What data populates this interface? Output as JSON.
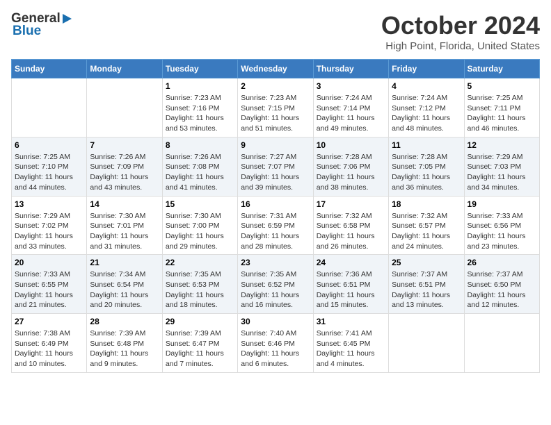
{
  "header": {
    "logo_general": "General",
    "logo_blue": "Blue",
    "title": "October 2024",
    "subtitle": "High Point, Florida, United States"
  },
  "calendar": {
    "days_of_week": [
      "Sunday",
      "Monday",
      "Tuesday",
      "Wednesday",
      "Thursday",
      "Friday",
      "Saturday"
    ],
    "weeks": [
      [
        {
          "day": "",
          "info": ""
        },
        {
          "day": "",
          "info": ""
        },
        {
          "day": "1",
          "info": "Sunrise: 7:23 AM\nSunset: 7:16 PM\nDaylight: 11 hours and 53 minutes."
        },
        {
          "day": "2",
          "info": "Sunrise: 7:23 AM\nSunset: 7:15 PM\nDaylight: 11 hours and 51 minutes."
        },
        {
          "day": "3",
          "info": "Sunrise: 7:24 AM\nSunset: 7:14 PM\nDaylight: 11 hours and 49 minutes."
        },
        {
          "day": "4",
          "info": "Sunrise: 7:24 AM\nSunset: 7:12 PM\nDaylight: 11 hours and 48 minutes."
        },
        {
          "day": "5",
          "info": "Sunrise: 7:25 AM\nSunset: 7:11 PM\nDaylight: 11 hours and 46 minutes."
        }
      ],
      [
        {
          "day": "6",
          "info": "Sunrise: 7:25 AM\nSunset: 7:10 PM\nDaylight: 11 hours and 44 minutes."
        },
        {
          "day": "7",
          "info": "Sunrise: 7:26 AM\nSunset: 7:09 PM\nDaylight: 11 hours and 43 minutes."
        },
        {
          "day": "8",
          "info": "Sunrise: 7:26 AM\nSunset: 7:08 PM\nDaylight: 11 hours and 41 minutes."
        },
        {
          "day": "9",
          "info": "Sunrise: 7:27 AM\nSunset: 7:07 PM\nDaylight: 11 hours and 39 minutes."
        },
        {
          "day": "10",
          "info": "Sunrise: 7:28 AM\nSunset: 7:06 PM\nDaylight: 11 hours and 38 minutes."
        },
        {
          "day": "11",
          "info": "Sunrise: 7:28 AM\nSunset: 7:05 PM\nDaylight: 11 hours and 36 minutes."
        },
        {
          "day": "12",
          "info": "Sunrise: 7:29 AM\nSunset: 7:03 PM\nDaylight: 11 hours and 34 minutes."
        }
      ],
      [
        {
          "day": "13",
          "info": "Sunrise: 7:29 AM\nSunset: 7:02 PM\nDaylight: 11 hours and 33 minutes."
        },
        {
          "day": "14",
          "info": "Sunrise: 7:30 AM\nSunset: 7:01 PM\nDaylight: 11 hours and 31 minutes."
        },
        {
          "day": "15",
          "info": "Sunrise: 7:30 AM\nSunset: 7:00 PM\nDaylight: 11 hours and 29 minutes."
        },
        {
          "day": "16",
          "info": "Sunrise: 7:31 AM\nSunset: 6:59 PM\nDaylight: 11 hours and 28 minutes."
        },
        {
          "day": "17",
          "info": "Sunrise: 7:32 AM\nSunset: 6:58 PM\nDaylight: 11 hours and 26 minutes."
        },
        {
          "day": "18",
          "info": "Sunrise: 7:32 AM\nSunset: 6:57 PM\nDaylight: 11 hours and 24 minutes."
        },
        {
          "day": "19",
          "info": "Sunrise: 7:33 AM\nSunset: 6:56 PM\nDaylight: 11 hours and 23 minutes."
        }
      ],
      [
        {
          "day": "20",
          "info": "Sunrise: 7:33 AM\nSunset: 6:55 PM\nDaylight: 11 hours and 21 minutes."
        },
        {
          "day": "21",
          "info": "Sunrise: 7:34 AM\nSunset: 6:54 PM\nDaylight: 11 hours and 20 minutes."
        },
        {
          "day": "22",
          "info": "Sunrise: 7:35 AM\nSunset: 6:53 PM\nDaylight: 11 hours and 18 minutes."
        },
        {
          "day": "23",
          "info": "Sunrise: 7:35 AM\nSunset: 6:52 PM\nDaylight: 11 hours and 16 minutes."
        },
        {
          "day": "24",
          "info": "Sunrise: 7:36 AM\nSunset: 6:51 PM\nDaylight: 11 hours and 15 minutes."
        },
        {
          "day": "25",
          "info": "Sunrise: 7:37 AM\nSunset: 6:51 PM\nDaylight: 11 hours and 13 minutes."
        },
        {
          "day": "26",
          "info": "Sunrise: 7:37 AM\nSunset: 6:50 PM\nDaylight: 11 hours and 12 minutes."
        }
      ],
      [
        {
          "day": "27",
          "info": "Sunrise: 7:38 AM\nSunset: 6:49 PM\nDaylight: 11 hours and 10 minutes."
        },
        {
          "day": "28",
          "info": "Sunrise: 7:39 AM\nSunset: 6:48 PM\nDaylight: 11 hours and 9 minutes."
        },
        {
          "day": "29",
          "info": "Sunrise: 7:39 AM\nSunset: 6:47 PM\nDaylight: 11 hours and 7 minutes."
        },
        {
          "day": "30",
          "info": "Sunrise: 7:40 AM\nSunset: 6:46 PM\nDaylight: 11 hours and 6 minutes."
        },
        {
          "day": "31",
          "info": "Sunrise: 7:41 AM\nSunset: 6:45 PM\nDaylight: 11 hours and 4 minutes."
        },
        {
          "day": "",
          "info": ""
        },
        {
          "day": "",
          "info": ""
        }
      ]
    ]
  }
}
